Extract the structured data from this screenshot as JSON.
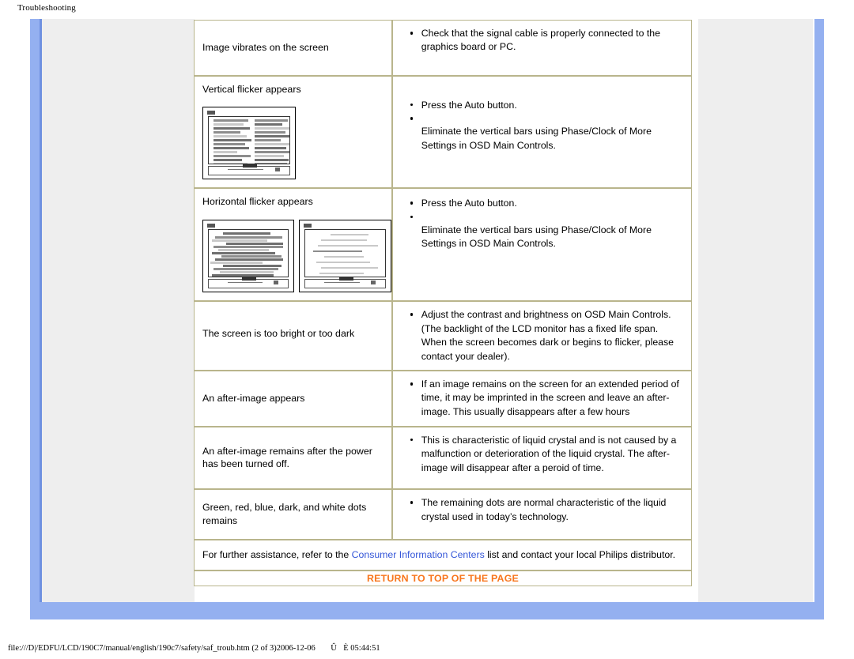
{
  "print": {
    "header": "Troubleshooting",
    "footer": "file:///D|/EDFU/LCD/190C7/manual/english/190c7/safety/saf_troub.htm (2 of 3)2006-12-06 ÛÈ 05:44:51"
  },
  "colors": {
    "frame_blue": "#94b0f0",
    "nav_gray": "#eeeeee",
    "table_border": "#b9b58c",
    "link_blue": "#3456d8",
    "return_orange": "#f8761d"
  },
  "table": {
    "rows": [
      {
        "symptom": "Image vibrates on the screen",
        "has_image": false,
        "fixes": [
          "Check that the signal cable is properly connected to the graphics board or PC."
        ]
      },
      {
        "symptom": "Vertical flicker appears",
        "has_image": true,
        "image_kind": "monitor-vertical-bars",
        "fixes": [
          "Press the Auto button.",
          "",
          "Eliminate the vertical bars using Phase/Clock of More Settings in OSD Main Controls."
        ]
      },
      {
        "symptom": "Horizontal flicker appears",
        "has_image": true,
        "image_kind": "monitor-horizontal-bars-pair",
        "fixes": [
          "Press the Auto button.",
          "",
          "Eliminate the vertical bars using Phase/Clock of More Settings in OSD Main Controls."
        ]
      },
      {
        "symptom": "The screen is too bright or too dark",
        "has_image": false,
        "fixes": [
          "Adjust the contrast and brightness on OSD Main Controls. (The backlight of the LCD monitor has a fixed life span. When the screen becomes dark or begins to flicker, please contact your dealer)."
        ]
      },
      {
        "symptom": "An after-image appears",
        "has_image": false,
        "fixes": [
          "If an image remains on the screen for an extended period of time, it may be imprinted in the screen and leave an after-image. This usually disappears after a few hours"
        ]
      },
      {
        "symptom": "An after-image remains after the power has been turned off.",
        "has_image": false,
        "fixes": [
          "This is characteristic of liquid crystal and is not caused by a malfunction or deterioration of the liquid crystal. The after-image will disappear after a peroid of time."
        ]
      },
      {
        "symptom": "Green, red, blue, dark, and white dots remains",
        "has_image": false,
        "fixes": [
          "The remaining dots are normal characteristic of the liquid crystal used in today’s technology."
        ]
      }
    ],
    "assistance": {
      "before_link": "For further assistance, refer to the ",
      "link": "Consumer Information Centers",
      "after_link": " list and contact your local Philips distributor."
    },
    "return_link": "RETURN TO TOP OF THE PAGE"
  }
}
